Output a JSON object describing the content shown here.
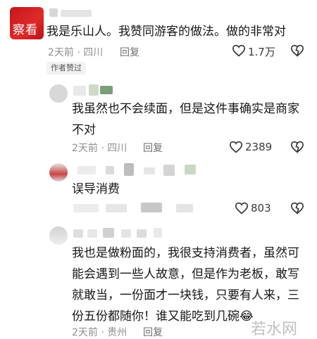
{
  "top_avatar_text": "察看",
  "comments": [
    {
      "text_lines": [
        "我是乐山人。我赞同游客的做法。做的非常对"
      ],
      "meta": "2天前 · 四川",
      "reply": "回复",
      "likes": "1.7万",
      "badge": "作者赞过"
    },
    {
      "text_lines": [
        "我虽然也不会续面，但是这件事确实是商家",
        "不对"
      ],
      "meta": "2天前 · 四川",
      "reply": "回复",
      "likes": "2389"
    },
    {
      "text_lines": [
        "误导消费"
      ],
      "likes": "803"
    },
    {
      "text_lines": [
        "我也是做粉面的，我很支持消费者，虽然可",
        "能会遇到一些人故意，但是作为老板，敢写",
        "就敢当，一份面才一块钱，只要有人来，三",
        "份五份都随你！谁又能吃到几碗"
      ],
      "emoji": "😂",
      "meta": "2天前 · 贵州",
      "reply": "回复"
    }
  ],
  "watermark": "若水网",
  "icons": {
    "like": "heart-outline-icon",
    "dislike": "broken-heart-icon"
  }
}
